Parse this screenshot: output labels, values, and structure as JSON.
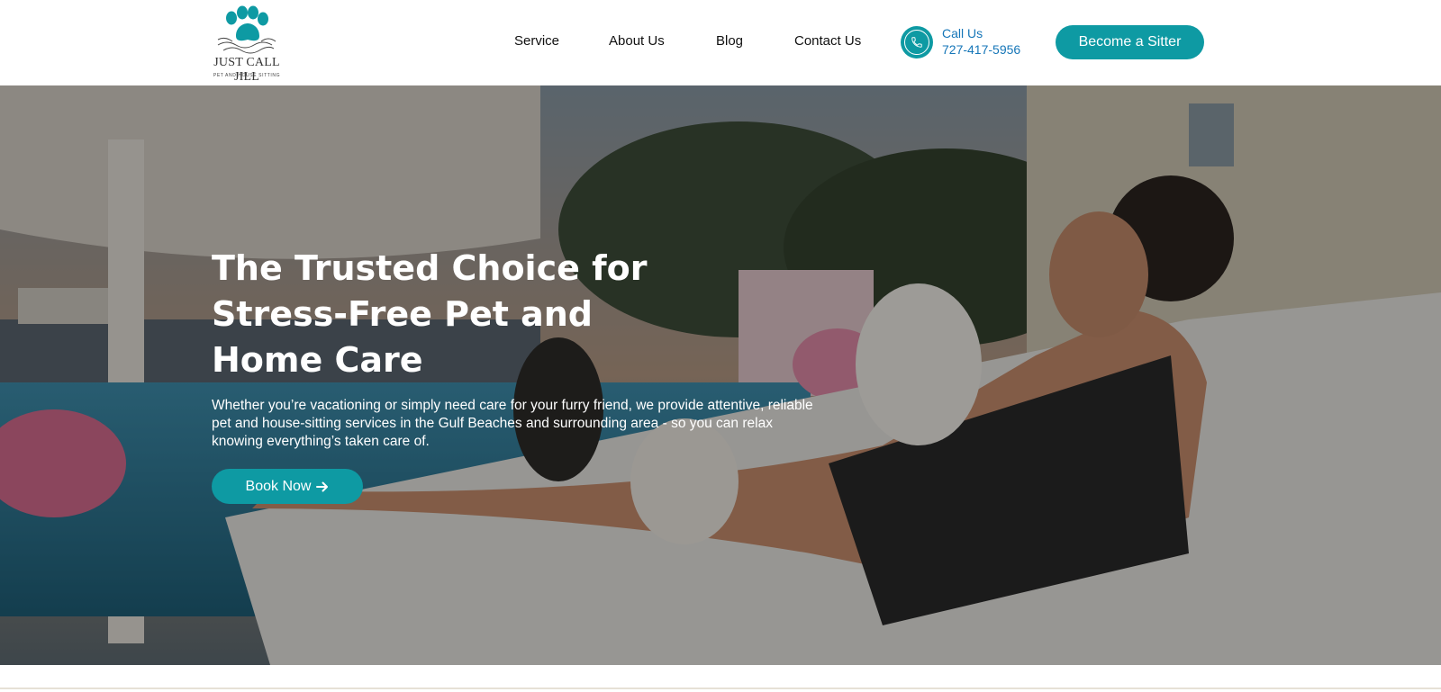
{
  "brand": {
    "name": "JUST CALL JILL",
    "tagline": "PET AND HOUSE SITTING",
    "accent_color": "#0e9aa3",
    "link_color": "#1676b8",
    "logo_icon": "paw-print-icon"
  },
  "nav": {
    "items": [
      {
        "label": "Service"
      },
      {
        "label": "About Us"
      },
      {
        "label": "Blog"
      },
      {
        "label": "Contact Us"
      }
    ]
  },
  "contact": {
    "icon": "phone-icon",
    "label": "Call Us",
    "phone": "727-417-5956"
  },
  "header": {
    "cta_label": "Become a Sitter"
  },
  "hero": {
    "title_lines": [
      "The Trusted Choice for",
      "Stress-Free Pet and",
      "Home Care"
    ],
    "description": "Whether you’re vacationing or simply need care for your furry friend, we provide attentive, reliable pet and house-sitting services in the Gulf Beaches and surrounding area - so you can relax knowing everything’s taken care of.",
    "cta_label": "Book Now",
    "cta_icon": "arrow-right-icon"
  }
}
